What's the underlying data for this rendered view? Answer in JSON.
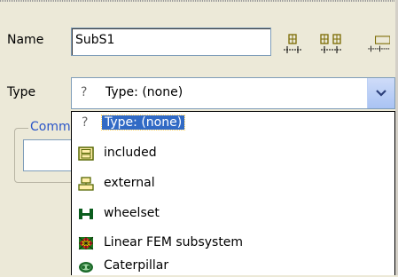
{
  "form": {
    "name_label": "Name",
    "name_value": "SubS1",
    "type_label": "Type",
    "type_selected": "Type: (none)",
    "comments_legend": "Comm"
  },
  "toolbar": [
    {
      "name": "add-element-button",
      "icon": "add-element-icon"
    },
    {
      "name": "add-multiple-button",
      "icon": "add-multiple-icon"
    },
    {
      "name": "add-element-alt-button",
      "icon": "add-element-alt-icon"
    }
  ],
  "type_options": [
    {
      "label": "Type: (none)",
      "icon": "question-icon",
      "selected": true
    },
    {
      "label": "included",
      "icon": "included-icon"
    },
    {
      "label": "external",
      "icon": "external-icon"
    },
    {
      "label": "wheelset",
      "icon": "wheelset-icon"
    },
    {
      "label": "Linear FEM subsystem",
      "icon": "fem-subsystem-icon"
    },
    {
      "label": "Caterpillar",
      "icon": "caterpillar-icon"
    }
  ],
  "colors": {
    "background": "#ECE9D8",
    "selection": "#316AC5",
    "comments_legend": "#2A55C8"
  }
}
